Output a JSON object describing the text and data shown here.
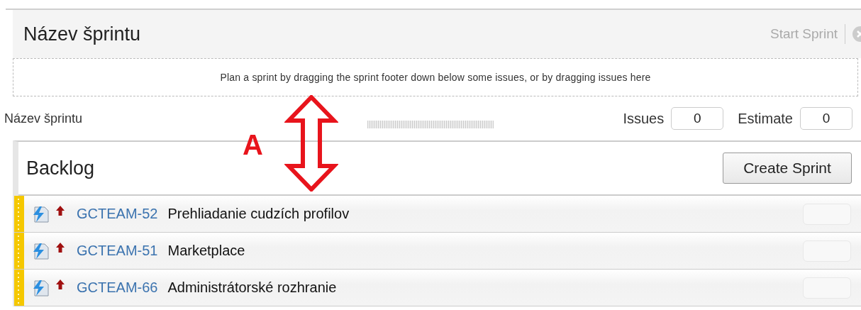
{
  "sprint": {
    "title": "Název šprintu",
    "start_button": "Start Sprint",
    "placeholder_text": "Plan a sprint by dragging the sprint footer down below some issues, or by dragging issues here"
  },
  "sprint_footer": {
    "name": "Název šprintu",
    "issues_label": "Issues",
    "issues_count": "0",
    "estimate_label": "Estimate",
    "estimate_value": "0"
  },
  "annotation": {
    "label": "A"
  },
  "backlog": {
    "title": "Backlog",
    "create_button": "Create Sprint",
    "issues": [
      {
        "key": "GCTEAM-52",
        "summary": "Prehliadanie cudzích profilov"
      },
      {
        "key": "GCTEAM-51",
        "summary": "Marketplace"
      },
      {
        "key": "GCTEAM-66",
        "summary": "Administrátorské rozhranie"
      }
    ]
  }
}
